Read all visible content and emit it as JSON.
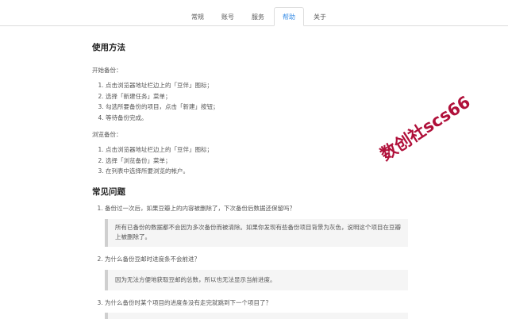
{
  "tabs": [
    {
      "label": "常规",
      "active": false
    },
    {
      "label": "账号",
      "active": false
    },
    {
      "label": "服务",
      "active": false
    },
    {
      "label": "帮助",
      "active": true
    },
    {
      "label": "关于",
      "active": false
    }
  ],
  "usage": {
    "heading": "使用方法",
    "backup_intro": "开始备份：",
    "backup_steps": [
      "点击浏览器地址栏边上的「豆伴」图标；",
      "选择「新建任务」菜单；",
      "勾选所要备份的项目，点击「新建」按钮；",
      "等待备份完成。"
    ],
    "browse_intro": "浏览备份：",
    "browse_steps": [
      "点击浏览器地址栏边上的「豆伴」图标；",
      "选择「浏览备份」菜单；",
      "在列表中选择所要浏览的帐户。"
    ]
  },
  "faq": {
    "heading": "常见问题",
    "items": [
      {
        "q": "备份过一次后，如果豆瓣上的内容被删除了，下次备份后数据还保留吗？",
        "a": "所有已备份的数据都不会因为多次备份而被清除。如果你发现有些备份项目背景为灰色，说明这个项目在豆瓣上被删除了。"
      },
      {
        "q": "为什么备份豆邮时进度条不会前进？",
        "a": "因为无法方便地获取豆邮的总数，所以也无法显示当前进度。"
      },
      {
        "q": "为什么备份时某个项目的进度条没有走完就跳到下一个项目了？",
        "a": ""
      }
    ]
  },
  "watermark": {
    "text": "数创社scs66",
    "color": "#b0103a"
  }
}
